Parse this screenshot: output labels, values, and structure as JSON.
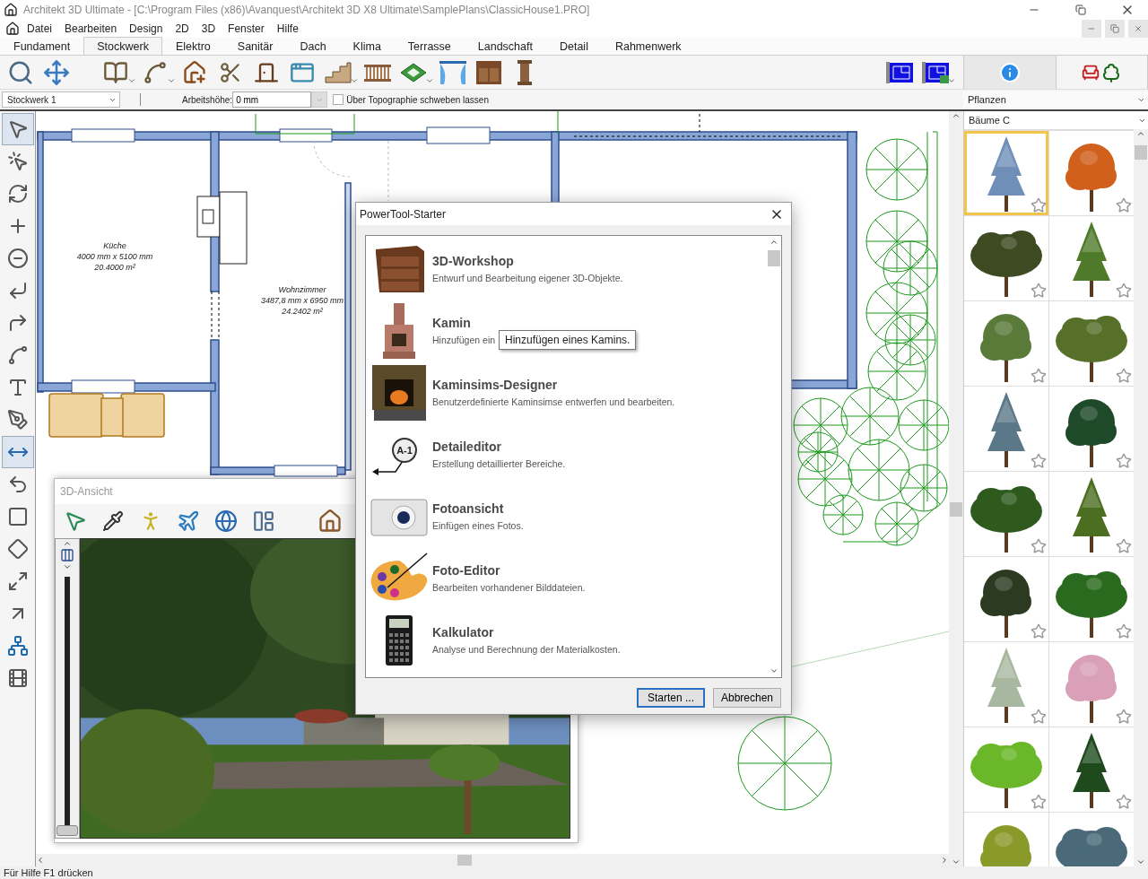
{
  "window": {
    "title": "Architekt 3D Ultimate - [C:\\Program Files (x86)\\Avanquest\\Architekt 3D X8 Ultimate\\SamplePlans\\ClassicHouse1.PRO]"
  },
  "menu": [
    "Datei",
    "Bearbeiten",
    "Design",
    "2D",
    "3D",
    "Fenster",
    "Hilfe"
  ],
  "ribbon_tabs": [
    {
      "label": "Fundament",
      "selected": false
    },
    {
      "label": "Stockwerk",
      "selected": true
    },
    {
      "label": "Elektro",
      "selected": false
    },
    {
      "label": "Sanitär",
      "selected": false
    },
    {
      "label": "Dach",
      "selected": false
    },
    {
      "label": "Klima",
      "selected": false
    },
    {
      "label": "Terrasse",
      "selected": false
    },
    {
      "label": "Landschaft",
      "selected": false
    },
    {
      "label": "Detail",
      "selected": false
    },
    {
      "label": "Rahmenwerk",
      "selected": false
    }
  ],
  "options": {
    "floor": "Stockwerk 1",
    "height_label": "Arbeitshöhe:",
    "height_value": "0 mm",
    "float_label": "Über Topographie schweben lassen",
    "float_checked": false
  },
  "left_tools": [
    {
      "selected": true
    },
    {
      "selected": false
    },
    {
      "selected": false
    },
    {
      "selected": false
    },
    {
      "selected": false
    },
    {
      "selected": false
    },
    {
      "selected": false
    },
    {
      "selected": false
    },
    {
      "selected": false
    },
    {
      "selected": false
    },
    {
      "selected": true
    },
    {
      "selected": false
    },
    {
      "selected": false
    },
    {
      "selected": false
    },
    {
      "selected": false
    },
    {
      "selected": false
    },
    {
      "selected": false
    },
    {
      "selected": false
    }
  ],
  "rooms": [
    {
      "name": "Küche",
      "size": "4000 mm x 5100 mm",
      "area": "20.4000 m²"
    },
    {
      "name": "Wohnzimmer",
      "size": "3487,8 mm x 6950 mm",
      "area": "24.2402 m²"
    }
  ],
  "view_3d": {
    "title": "3D-Ansicht",
    "level": 0
  },
  "library": {
    "category": "Pflanzen",
    "subcategory": "Bäume C",
    "tiles": [
      {
        "selected": true,
        "favorite": true
      },
      {
        "selected": false,
        "favorite": true
      },
      {
        "selected": false,
        "favorite": true
      },
      {
        "selected": false,
        "favorite": true
      },
      {
        "selected": false,
        "favorite": true
      },
      {
        "selected": false,
        "favorite": true
      },
      {
        "selected": false,
        "favorite": true
      },
      {
        "selected": false,
        "favorite": true
      },
      {
        "selected": false,
        "favorite": true
      },
      {
        "selected": false,
        "favorite": true
      },
      {
        "selected": false,
        "favorite": true
      },
      {
        "selected": false,
        "favorite": true
      },
      {
        "selected": false,
        "favorite": true
      },
      {
        "selected": false,
        "favorite": true
      },
      {
        "selected": false,
        "favorite": true
      },
      {
        "selected": false,
        "favorite": true
      },
      {
        "selected": false
      },
      {
        "selected": false
      }
    ]
  },
  "dialog": {
    "title": "PowerTool-Starter",
    "tools": [
      {
        "name": "3D-Workshop",
        "description": "Entwurf und Bearbeitung eigener 3D-Objekte."
      },
      {
        "name": "Kamin",
        "description": "Hinzufügen ein"
      },
      {
        "name": "Kaminsims-Designer",
        "description": "Benutzerdefinierte Kaminsimse entwerfen und bearbeiten."
      },
      {
        "name": "Detaileditor",
        "description": "Erstellung detaillierter Bereiche."
      },
      {
        "name": "Fotoansicht",
        "description": "Einfügen eines Fotos."
      },
      {
        "name": "Foto-Editor",
        "description": "Bearbeiten vorhandener Bilddateien."
      },
      {
        "name": "Kalkulator",
        "description": "Analyse und Berechnung der Materialkosten."
      }
    ],
    "tooltip": "Hinzufügen eines Kamins.",
    "detail_badge": "A-1",
    "buttons": [
      {
        "label": "Starten ...",
        "primary": true
      },
      {
        "label": "Abbrechen",
        "primary": false
      }
    ]
  },
  "status_bar": "Für Hilfe F1 drücken"
}
